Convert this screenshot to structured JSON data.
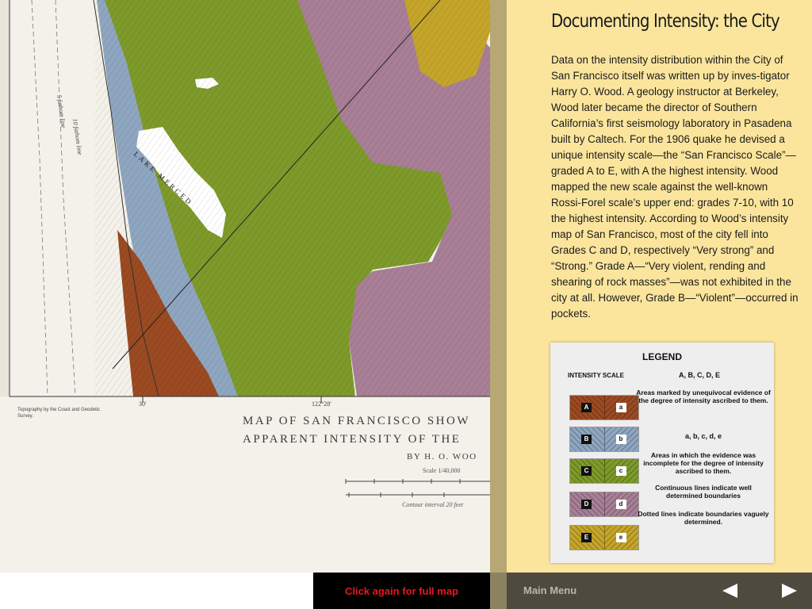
{
  "map": {
    "title_line_1": "MAP OF SAN FRANCISCO SHOW",
    "title_line_2": "APPARENT INTENSITY OF THE",
    "author": "BY H. O. WOO",
    "scale": "Scale 1/40,000",
    "contour": "Contour interval 20 feet",
    "credit": "Topography by the Coast and Geodetic Survey.",
    "coord_minutes": "30'",
    "coord_longitude": "122°28'",
    "label_lake": "LAKE MERCED",
    "label_fathom_1": "5 fathom line",
    "label_fathom_2": "10 fathom line"
  },
  "panel": {
    "title": "Documenting Intensity: the City",
    "body": "Data on the intensity distribution within the City of San Francisco itself was written up by inves-tigator Harry O. Wood. A geology instructor at Berkeley, Wood later became the director of Southern California’s first seismology laboratory in Pasadena built by Caltech. For the 1906 quake he devised a unique intensity scale—the “San Francisco Scale”—graded A to E, with A the highest intensity. Wood mapped the new scale against the well-known Rossi-Forel scale’s upper end: grades 7-10, with 10 the highest intensity. According to Wood’s intensity map of San Francisco, most of the city fell into Grades C and D, respectively “Very strong” and “Strong.” Grade A—“Very violent, rending and shearing of rock masses”—was not exhibited in the city at all. However, Grade B—“Violent”—occurred in pockets."
  },
  "legend": {
    "title": "LEGEND",
    "scale_label": "INTENSITY SCALE",
    "letters_upper": "A, B, C, D, E",
    "desc_upper": "Areas marked by unequivocal evidence of the degree of intensity ascribed to them.",
    "letters_lower": "a, b, c, d, e",
    "desc_lower": "Areas in which the evidence was incomplete for the degree of intensity ascribed to them.",
    "desc_continuous": "Continuous lines indicate well determined boundaries",
    "desc_dotted": "Dotted lines indicate boundaries vaguely determined.",
    "swatches": [
      {
        "upper": "A",
        "lower": "a",
        "color": "#9b4a22"
      },
      {
        "upper": "B",
        "lower": "b",
        "color": "#8fa6c0"
      },
      {
        "upper": "C",
        "lower": "c",
        "color": "#7e9a2a"
      },
      {
        "upper": "D",
        "lower": "d",
        "color": "#a87f96"
      },
      {
        "upper": "E",
        "lower": "e",
        "color": "#c4a52a"
      }
    ]
  },
  "nav": {
    "full_map_label": "Click again for full map",
    "main_menu_label": "Main Menu",
    "prev_icon": "left-triangle-icon",
    "next_icon": "right-triangle-icon"
  },
  "colors": {
    "panel_bg": "#fbe59d",
    "nav_bg": "#4f4a3f",
    "full_map_text": "#e8161c",
    "grade_a": "#9b4a22",
    "grade_b": "#8fa6c0",
    "grade_c": "#7e9a2a",
    "grade_d": "#a87f96",
    "grade_e": "#c4a52a"
  }
}
